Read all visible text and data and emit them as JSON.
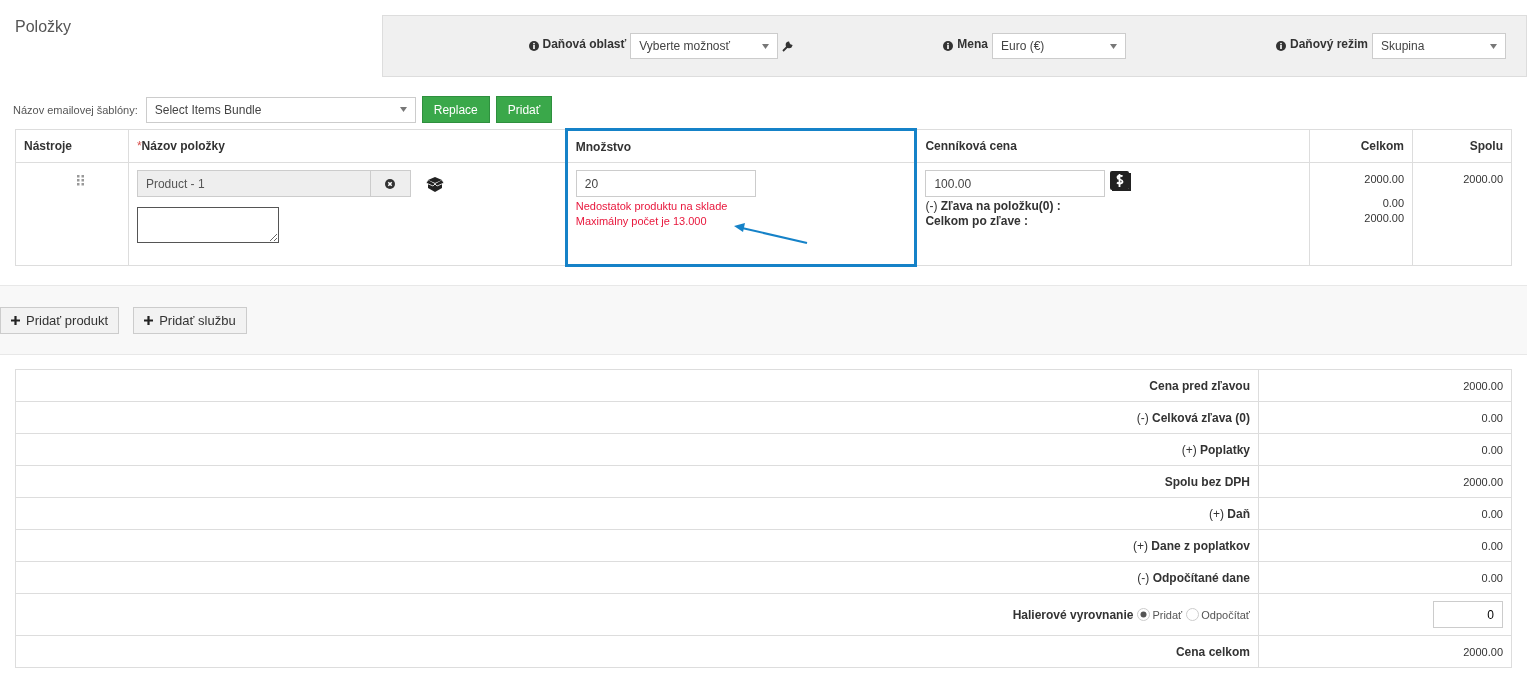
{
  "title": "Položky",
  "tax_bar": {
    "fields": [
      {
        "label": "Daňová oblasť",
        "value": "Vyberte možnosť",
        "kind": "tool"
      },
      {
        "label": "Mena",
        "value": "Euro (€)",
        "kind": "plain"
      },
      {
        "label": "Daňový režim",
        "value": "Skupina",
        "kind": "plain"
      }
    ]
  },
  "template": {
    "label": "Názov emailovej šablóny:",
    "value": "Select Items Bundle",
    "buttons": [
      "Replace",
      "Pridať"
    ]
  },
  "items_table": {
    "columns": [
      {
        "label": "Nástroje"
      },
      {
        "label": "Názov položky",
        "required_mark": "*"
      },
      {
        "label": "Množstvo"
      },
      {
        "label": "Cenníková cena"
      },
      {
        "label": "Celkom"
      },
      {
        "label": "Spolu"
      }
    ],
    "rows": [
      {
        "product": "Product - 1",
        "quantity": "20",
        "warnings": [
          "Nedostatok produktu na sklade",
          "Maximálny počet je 13.000"
        ],
        "list_price": "100.00",
        "discount_label": "(-) **Zľava na položku(0) :**",
        "after_discount_label": "Celkom po zľave :",
        "total": "2000.00",
        "discount_value": "0.00",
        "total_after_discount": "2000.00",
        "sum": "2000.00"
      }
    ]
  },
  "add_buttons": [
    "Pridať produkt",
    "Pridať službu"
  ],
  "summary": {
    "rows": [
      {
        "kind": "plain",
        "label": "**Cena pred zľavou**",
        "value": "2000.00"
      },
      {
        "kind": "plain",
        "label": "(-) **Celková zľava (0)**",
        "value": "0.00"
      },
      {
        "kind": "plain",
        "label": "(+) **Poplatky**",
        "value": "0.00"
      },
      {
        "kind": "plain",
        "label": "**Spolu bez DPH**",
        "value": "2000.00"
      },
      {
        "kind": "plain",
        "label": "(+) **Daň**",
        "value": "0.00"
      },
      {
        "kind": "plain",
        "label": "(+) **Dane z poplatkov**",
        "value": "0.00"
      },
      {
        "kind": "plain",
        "label": "(-) **Odpočítané dane**",
        "value": "0.00"
      },
      {
        "kind": "rounding",
        "label": "**Halierové vyrovnanie**",
        "options": [
          {
            "label": "Pridať",
            "selected": true
          },
          {
            "label": "Odpočítať",
            "selected": false
          }
        ],
        "value": "0"
      },
      {
        "kind": "plain",
        "label": "**Cena celkom**",
        "value": "2000.00"
      }
    ]
  }
}
